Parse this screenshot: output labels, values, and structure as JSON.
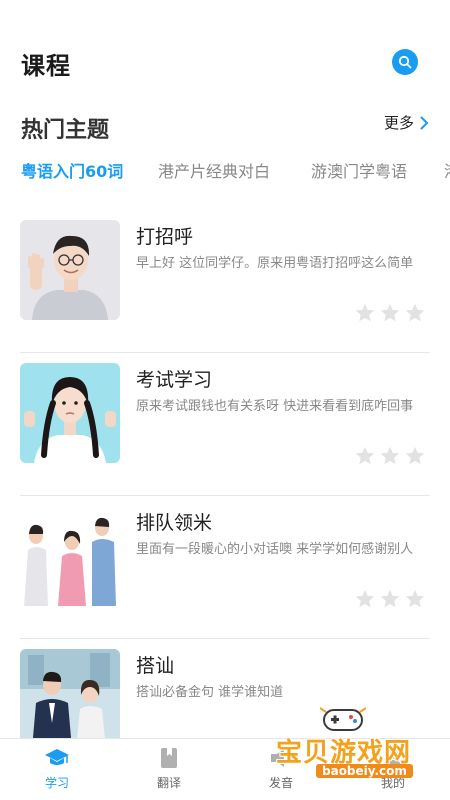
{
  "header": {
    "title": "课程",
    "search_icon": "search-icon",
    "accent_color": "#1a9cf0"
  },
  "section": {
    "title": "热门主题",
    "more_label": "更多"
  },
  "topic_tabs": [
    {
      "label": "粤语入门60词",
      "active": true
    },
    {
      "label": "港产片经典对白",
      "active": false
    },
    {
      "label": "游澳门学粤语",
      "active": false
    },
    {
      "label": "港",
      "active": false
    }
  ],
  "courses": [
    {
      "title": "打招呼",
      "desc": "早上好 这位同学仔。原来用粤语打招呼这么简单",
      "rating": 0,
      "rating_max": 3
    },
    {
      "title": "考试学习",
      "desc": "原来考试跟钱也有关系呀 快进来看看到底咋回事",
      "rating": 0,
      "rating_max": 3
    },
    {
      "title": "排队领米",
      "desc": "里面有一段暖心的小对话噢 来学学如何感谢别人",
      "rating": 0,
      "rating_max": 3
    },
    {
      "title": "搭讪",
      "desc": "搭讪必备金句 谁学谁知道",
      "rating": 0,
      "rating_max": 3
    }
  ],
  "tabbar": [
    {
      "label": "学习",
      "icon": "graduation-cap-icon",
      "active": true
    },
    {
      "label": "翻译",
      "icon": "book-icon",
      "active": false
    },
    {
      "label": "发音",
      "icon": "speaker-icon",
      "active": false
    },
    {
      "label": "我的",
      "icon": "person-icon",
      "active": false
    }
  ],
  "watermark": {
    "text": "宝贝游戏网",
    "domain": "baobeiy.com"
  }
}
